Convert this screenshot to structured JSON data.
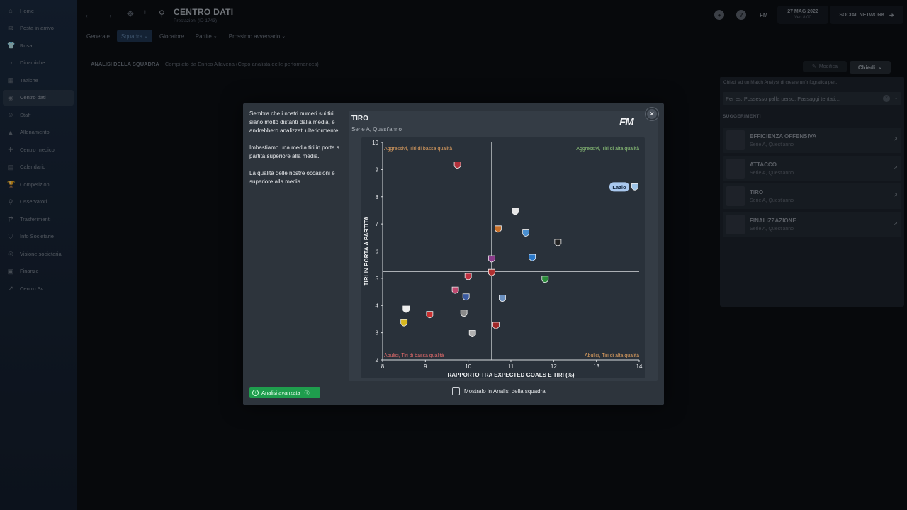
{
  "sidebar": {
    "items": [
      {
        "label": "Home",
        "icon": "home-icon"
      },
      {
        "label": "Posta in arrivo",
        "icon": "inbox-icon"
      },
      {
        "label": "Rosa",
        "icon": "shirt-icon"
      },
      {
        "label": "Dinamiche",
        "icon": "dynamics-icon"
      },
      {
        "label": "Tattiche",
        "icon": "tactics-icon"
      },
      {
        "label": "Centro dati",
        "icon": "data-hub-icon"
      },
      {
        "label": "Staff",
        "icon": "staff-icon"
      },
      {
        "label": "Allenamento",
        "icon": "training-icon"
      },
      {
        "label": "Centro medico",
        "icon": "medical-icon"
      },
      {
        "label": "Calendario",
        "icon": "calendar-icon"
      },
      {
        "label": "Competizioni",
        "icon": "trophy-icon"
      },
      {
        "label": "Osservatori",
        "icon": "scouting-icon"
      },
      {
        "label": "Trasferimenti",
        "icon": "transfers-icon"
      },
      {
        "label": "Info Societarie",
        "icon": "club-info-icon"
      },
      {
        "label": "Visione societaria",
        "icon": "club-vision-icon"
      },
      {
        "label": "Finanze",
        "icon": "finances-icon"
      },
      {
        "label": "Centro Sv.",
        "icon": "development-icon"
      }
    ],
    "active_index": 5
  },
  "topbar": {
    "title": "CENTRO DATI",
    "subtitle": "Prestazioni (ID 1743)",
    "fm_label": "FM",
    "date_main": "27 MAG 2022",
    "date_sub": "Ven 8:00",
    "social_label": "SOCIAL NETWORK"
  },
  "tabs": [
    {
      "label": "Generale",
      "dropdown": false
    },
    {
      "label": "Squadra",
      "dropdown": true
    },
    {
      "label": "Giocatore",
      "dropdown": false
    },
    {
      "label": "Partite",
      "dropdown": true
    },
    {
      "label": "Prossimo avversario",
      "dropdown": true
    }
  ],
  "analysis": {
    "heading": "ANALISI DELLA SQUADRA",
    "compiled": "Compilato da Enrico Allavena (Capo analista delle performances)",
    "modifica_label": "Modifica",
    "chiedi_label": "Chiedi"
  },
  "ask_panel": {
    "prompt": "Chiedi ad un Match Analyst di creare un'infografica per...",
    "placeholder": "Per es. Possesso palla perso, Passaggi tentati...",
    "suggestions_title": "SUGGERIMENTI",
    "suggestions": [
      {
        "name": "EFFICIENZA OFFENSIVA",
        "sub": "Serie A, Quest'anno"
      },
      {
        "name": "ATTACCO",
        "sub": "Serie A, Quest'anno"
      },
      {
        "name": "TIRO",
        "sub": "Serie A, Quest'anno"
      },
      {
        "name": "FINALIZZAZIONE",
        "sub": "Serie A, Quest'anno"
      }
    ]
  },
  "modal": {
    "text": [
      "Sembra che i nostri numeri sui tiri siano molto distanti dalla media, e andrebbero analizzati ulteriormente.",
      "Imbastiamo una media tiri in porta a partita superiore alla media.",
      "La qualità delle nostre occasioni è superiore alla media."
    ],
    "advanced_label": "Analisi avanzata",
    "show_label": "Mostralo in Analisi della squadra",
    "close_icon": "close-icon"
  },
  "chart_data": {
    "type": "scatter",
    "title": "TIRO",
    "subtitle": "Serie A, Quest'anno",
    "brand": "FM",
    "xlabel": "RAPPORTO TRA EXPECTED GOALS E TIRI (%)",
    "ylabel": "TIRI IN PORTA A PARTITA",
    "xlim": [
      8,
      14
    ],
    "ylim": [
      2,
      10
    ],
    "x_ticks": [
      "8",
      "9",
      "10",
      "11",
      "12",
      "13",
      "14"
    ],
    "y_ticks": [
      "2",
      "3",
      "4",
      "5",
      "6",
      "7",
      "8",
      "9",
      "10"
    ],
    "avg_x": 10.55,
    "avg_y": 5.25,
    "quadrants": {
      "top_left": "Aggressivi, Tiri di bassa qualità",
      "top_right": "Aggressivi, Tiri di alta qualità",
      "bottom_left": "Abulici, Tiri di bassa qualità",
      "bottom_right": "Abulici, Tiri di alta qualità"
    },
    "colors": {
      "top_left": "#e0a060",
      "top_right": "#8fc77a",
      "bottom_left": "#e06a6a",
      "bottom_right": "#e0a060",
      "highlight": "#a9c8ee"
    },
    "highlight_label": "Lazio",
    "points": [
      {
        "x": 13.9,
        "y": 8.35,
        "color": "#9dc3e6",
        "highlight": true
      },
      {
        "x": 9.75,
        "y": 9.15,
        "color": "#b0303a"
      },
      {
        "x": 11.1,
        "y": 7.45,
        "color": "#e6e6e6"
      },
      {
        "x": 10.7,
        "y": 6.8,
        "color": "#c8702a"
      },
      {
        "x": 11.35,
        "y": 6.65,
        "color": "#4a8fd0"
      },
      {
        "x": 12.1,
        "y": 6.3,
        "color": "#222222"
      },
      {
        "x": 11.5,
        "y": 5.75,
        "color": "#2a78c8"
      },
      {
        "x": 10.55,
        "y": 5.7,
        "color": "#8a3a8a"
      },
      {
        "x": 10.55,
        "y": 5.2,
        "color": "#b03030"
      },
      {
        "x": 10.0,
        "y": 5.05,
        "color": "#c03040"
      },
      {
        "x": 11.8,
        "y": 4.95,
        "color": "#2a8a3a"
      },
      {
        "x": 9.7,
        "y": 4.55,
        "color": "#c04a70"
      },
      {
        "x": 9.95,
        "y": 4.3,
        "color": "#3a5aa0"
      },
      {
        "x": 10.8,
        "y": 4.25,
        "color": "#6a90c0"
      },
      {
        "x": 8.55,
        "y": 3.85,
        "color": "#eeeeee"
      },
      {
        "x": 9.1,
        "y": 3.65,
        "color": "#c83030"
      },
      {
        "x": 9.9,
        "y": 3.7,
        "color": "#8a8a8a"
      },
      {
        "x": 8.5,
        "y": 3.35,
        "color": "#d8b820"
      },
      {
        "x": 10.65,
        "y": 3.25,
        "color": "#a02828"
      },
      {
        "x": 10.1,
        "y": 2.95,
        "color": "#b0b0b0"
      }
    ]
  }
}
